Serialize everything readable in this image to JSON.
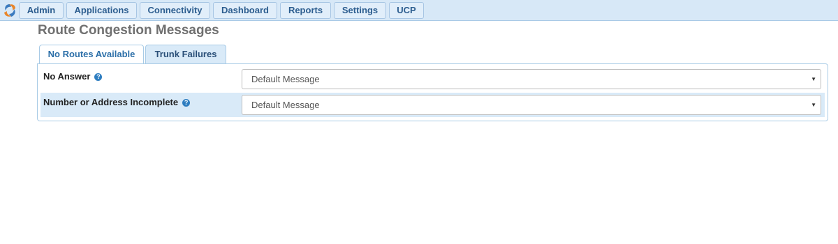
{
  "nav": {
    "items": [
      {
        "label": "Admin"
      },
      {
        "label": "Applications"
      },
      {
        "label": "Connectivity"
      },
      {
        "label": "Dashboard"
      },
      {
        "label": "Reports"
      },
      {
        "label": "Settings"
      },
      {
        "label": "UCP"
      }
    ],
    "logo_icon": "freepbx-swirl-icon"
  },
  "page": {
    "title": "Route Congestion Messages"
  },
  "tabs": [
    {
      "label": "No Routes Available",
      "active": false
    },
    {
      "label": "Trunk Failures",
      "active": true
    }
  ],
  "form": {
    "rows": [
      {
        "label": "No Answer",
        "help_icon": "question-circle-icon",
        "value": "Default Message"
      },
      {
        "label": "Number or Address Incomplete",
        "help_icon": "question-circle-icon",
        "value": "Default Message"
      }
    ]
  },
  "colors": {
    "nav_bg": "#d7e8f7",
    "nav_text": "#2c5d8f",
    "tab_text": "#2c6fa8",
    "help_icon": "#2d7dc0",
    "row_highlight": "#d9eaf8"
  }
}
